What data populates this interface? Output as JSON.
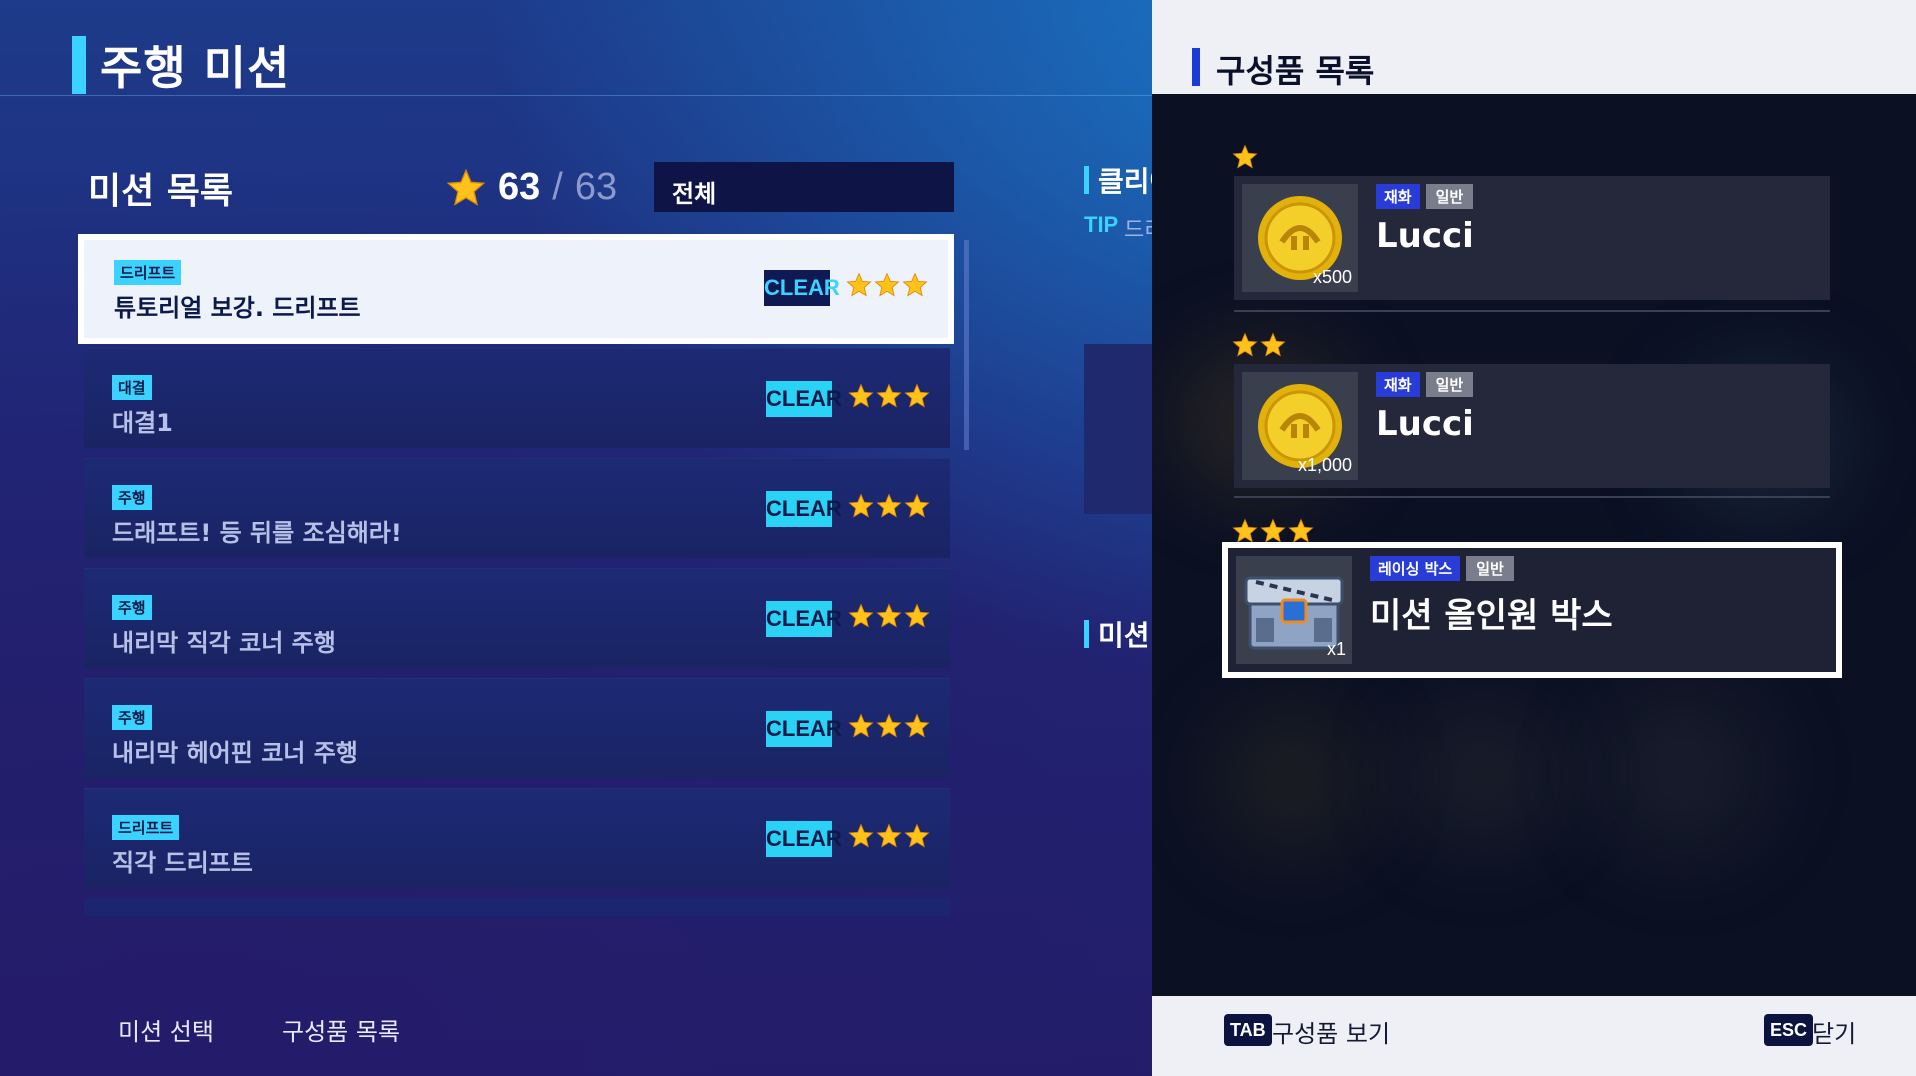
{
  "header": {
    "title": "주행 미션"
  },
  "mission_list": {
    "title": "미션 목록",
    "stars_current": "63",
    "stars_separator": "/",
    "stars_max": "63",
    "filter_value": "전체",
    "items": [
      {
        "tag": "드리프트",
        "name": "튜토리얼 보강. 드리프트",
        "status": "CLEAR",
        "stars": 3
      },
      {
        "tag": "대결",
        "name": "대결1",
        "status": "CLEAR",
        "stars": 3
      },
      {
        "tag": "주행",
        "name": "드래프트! 등 뒤를 조심해라!",
        "status": "CLEAR",
        "stars": 3
      },
      {
        "tag": "주행",
        "name": "내리막 직각 코너 주행",
        "status": "CLEAR",
        "stars": 3
      },
      {
        "tag": "주행",
        "name": "내리막 헤어핀 코너 주행",
        "status": "CLEAR",
        "stars": 3
      },
      {
        "tag": "드리프트",
        "name": "직각 드리프트",
        "status": "CLEAR",
        "stars": 3
      }
    ]
  },
  "middle": {
    "section1_label": "클리어",
    "tip_label": "TIP",
    "tip_text": "드리",
    "section2_label": "미션"
  },
  "footer_left": {
    "mission_select": "미션 선택",
    "reward_list": "구성품 목록"
  },
  "reward_panel": {
    "title": "구성품 목록",
    "rewards": [
      {
        "tier": 1,
        "type": "재화",
        "grade": "일반",
        "name": "Lucci",
        "qty": "x500",
        "icon": "lucci-coin-icon"
      },
      {
        "tier": 2,
        "type": "재화",
        "grade": "일반",
        "name": "Lucci",
        "qty": "x1,000",
        "icon": "lucci-coin-icon"
      },
      {
        "tier": 3,
        "type": "레이싱 박스",
        "grade": "일반",
        "name": "미션 올인원 박스",
        "qty": "x1",
        "icon": "racing-box-icon"
      }
    ],
    "footer": {
      "tab_key": "TAB",
      "tab_label": "구성품 보기",
      "esc_key": "ESC",
      "esc_label": "닫기"
    }
  },
  "colors": {
    "accent_cyan": "#3ad3ff",
    "star_gold": "#ffc21a",
    "panel_blue": "#1a3bd6"
  }
}
